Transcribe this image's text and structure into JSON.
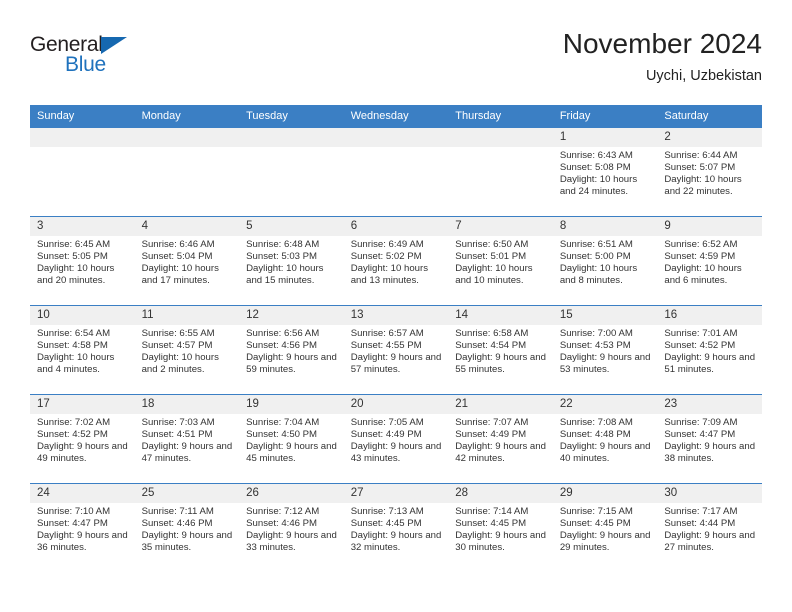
{
  "brand": {
    "name_part1": "General",
    "name_part2": "Blue",
    "triangle_color": "#1668b0",
    "blue_color": "#1f72bd"
  },
  "header": {
    "title": "November 2024",
    "subtitle": "Uychi, Uzbekistan"
  },
  "calendar": {
    "accent_color": "#3b7fc4",
    "daynum_bg": "#f0f0f0",
    "weekdays": [
      "Sunday",
      "Monday",
      "Tuesday",
      "Wednesday",
      "Thursday",
      "Friday",
      "Saturday"
    ],
    "labels": {
      "sunrise": "Sunrise:",
      "sunset": "Sunset:",
      "daylight": "Daylight:"
    },
    "weeks": [
      [
        {
          "day": "",
          "empty": true
        },
        {
          "day": "",
          "empty": true
        },
        {
          "day": "",
          "empty": true
        },
        {
          "day": "",
          "empty": true
        },
        {
          "day": "",
          "empty": true
        },
        {
          "day": "1",
          "sunrise": "Sunrise: 6:43 AM",
          "sunset": "Sunset: 5:08 PM",
          "daylight": "Daylight: 10 hours and 24 minutes."
        },
        {
          "day": "2",
          "sunrise": "Sunrise: 6:44 AM",
          "sunset": "Sunset: 5:07 PM",
          "daylight": "Daylight: 10 hours and 22 minutes."
        }
      ],
      [
        {
          "day": "3",
          "sunrise": "Sunrise: 6:45 AM",
          "sunset": "Sunset: 5:05 PM",
          "daylight": "Daylight: 10 hours and 20 minutes."
        },
        {
          "day": "4",
          "sunrise": "Sunrise: 6:46 AM",
          "sunset": "Sunset: 5:04 PM",
          "daylight": "Daylight: 10 hours and 17 minutes."
        },
        {
          "day": "5",
          "sunrise": "Sunrise: 6:48 AM",
          "sunset": "Sunset: 5:03 PM",
          "daylight": "Daylight: 10 hours and 15 minutes."
        },
        {
          "day": "6",
          "sunrise": "Sunrise: 6:49 AM",
          "sunset": "Sunset: 5:02 PM",
          "daylight": "Daylight: 10 hours and 13 minutes."
        },
        {
          "day": "7",
          "sunrise": "Sunrise: 6:50 AM",
          "sunset": "Sunset: 5:01 PM",
          "daylight": "Daylight: 10 hours and 10 minutes."
        },
        {
          "day": "8",
          "sunrise": "Sunrise: 6:51 AM",
          "sunset": "Sunset: 5:00 PM",
          "daylight": "Daylight: 10 hours and 8 minutes."
        },
        {
          "day": "9",
          "sunrise": "Sunrise: 6:52 AM",
          "sunset": "Sunset: 4:59 PM",
          "daylight": "Daylight: 10 hours and 6 minutes."
        }
      ],
      [
        {
          "day": "10",
          "sunrise": "Sunrise: 6:54 AM",
          "sunset": "Sunset: 4:58 PM",
          "daylight": "Daylight: 10 hours and 4 minutes."
        },
        {
          "day": "11",
          "sunrise": "Sunrise: 6:55 AM",
          "sunset": "Sunset: 4:57 PM",
          "daylight": "Daylight: 10 hours and 2 minutes."
        },
        {
          "day": "12",
          "sunrise": "Sunrise: 6:56 AM",
          "sunset": "Sunset: 4:56 PM",
          "daylight": "Daylight: 9 hours and 59 minutes."
        },
        {
          "day": "13",
          "sunrise": "Sunrise: 6:57 AM",
          "sunset": "Sunset: 4:55 PM",
          "daylight": "Daylight: 9 hours and 57 minutes."
        },
        {
          "day": "14",
          "sunrise": "Sunrise: 6:58 AM",
          "sunset": "Sunset: 4:54 PM",
          "daylight": "Daylight: 9 hours and 55 minutes."
        },
        {
          "day": "15",
          "sunrise": "Sunrise: 7:00 AM",
          "sunset": "Sunset: 4:53 PM",
          "daylight": "Daylight: 9 hours and 53 minutes."
        },
        {
          "day": "16",
          "sunrise": "Sunrise: 7:01 AM",
          "sunset": "Sunset: 4:52 PM",
          "daylight": "Daylight: 9 hours and 51 minutes."
        }
      ],
      [
        {
          "day": "17",
          "sunrise": "Sunrise: 7:02 AM",
          "sunset": "Sunset: 4:52 PM",
          "daylight": "Daylight: 9 hours and 49 minutes."
        },
        {
          "day": "18",
          "sunrise": "Sunrise: 7:03 AM",
          "sunset": "Sunset: 4:51 PM",
          "daylight": "Daylight: 9 hours and 47 minutes."
        },
        {
          "day": "19",
          "sunrise": "Sunrise: 7:04 AM",
          "sunset": "Sunset: 4:50 PM",
          "daylight": "Daylight: 9 hours and 45 minutes."
        },
        {
          "day": "20",
          "sunrise": "Sunrise: 7:05 AM",
          "sunset": "Sunset: 4:49 PM",
          "daylight": "Daylight: 9 hours and 43 minutes."
        },
        {
          "day": "21",
          "sunrise": "Sunrise: 7:07 AM",
          "sunset": "Sunset: 4:49 PM",
          "daylight": "Daylight: 9 hours and 42 minutes."
        },
        {
          "day": "22",
          "sunrise": "Sunrise: 7:08 AM",
          "sunset": "Sunset: 4:48 PM",
          "daylight": "Daylight: 9 hours and 40 minutes."
        },
        {
          "day": "23",
          "sunrise": "Sunrise: 7:09 AM",
          "sunset": "Sunset: 4:47 PM",
          "daylight": "Daylight: 9 hours and 38 minutes."
        }
      ],
      [
        {
          "day": "24",
          "sunrise": "Sunrise: 7:10 AM",
          "sunset": "Sunset: 4:47 PM",
          "daylight": "Daylight: 9 hours and 36 minutes."
        },
        {
          "day": "25",
          "sunrise": "Sunrise: 7:11 AM",
          "sunset": "Sunset: 4:46 PM",
          "daylight": "Daylight: 9 hours and 35 minutes."
        },
        {
          "day": "26",
          "sunrise": "Sunrise: 7:12 AM",
          "sunset": "Sunset: 4:46 PM",
          "daylight": "Daylight: 9 hours and 33 minutes."
        },
        {
          "day": "27",
          "sunrise": "Sunrise: 7:13 AM",
          "sunset": "Sunset: 4:45 PM",
          "daylight": "Daylight: 9 hours and 32 minutes."
        },
        {
          "day": "28",
          "sunrise": "Sunrise: 7:14 AM",
          "sunset": "Sunset: 4:45 PM",
          "daylight": "Daylight: 9 hours and 30 minutes."
        },
        {
          "day": "29",
          "sunrise": "Sunrise: 7:15 AM",
          "sunset": "Sunset: 4:45 PM",
          "daylight": "Daylight: 9 hours and 29 minutes."
        },
        {
          "day": "30",
          "sunrise": "Sunrise: 7:17 AM",
          "sunset": "Sunset: 4:44 PM",
          "daylight": "Daylight: 9 hours and 27 minutes."
        }
      ]
    ]
  }
}
